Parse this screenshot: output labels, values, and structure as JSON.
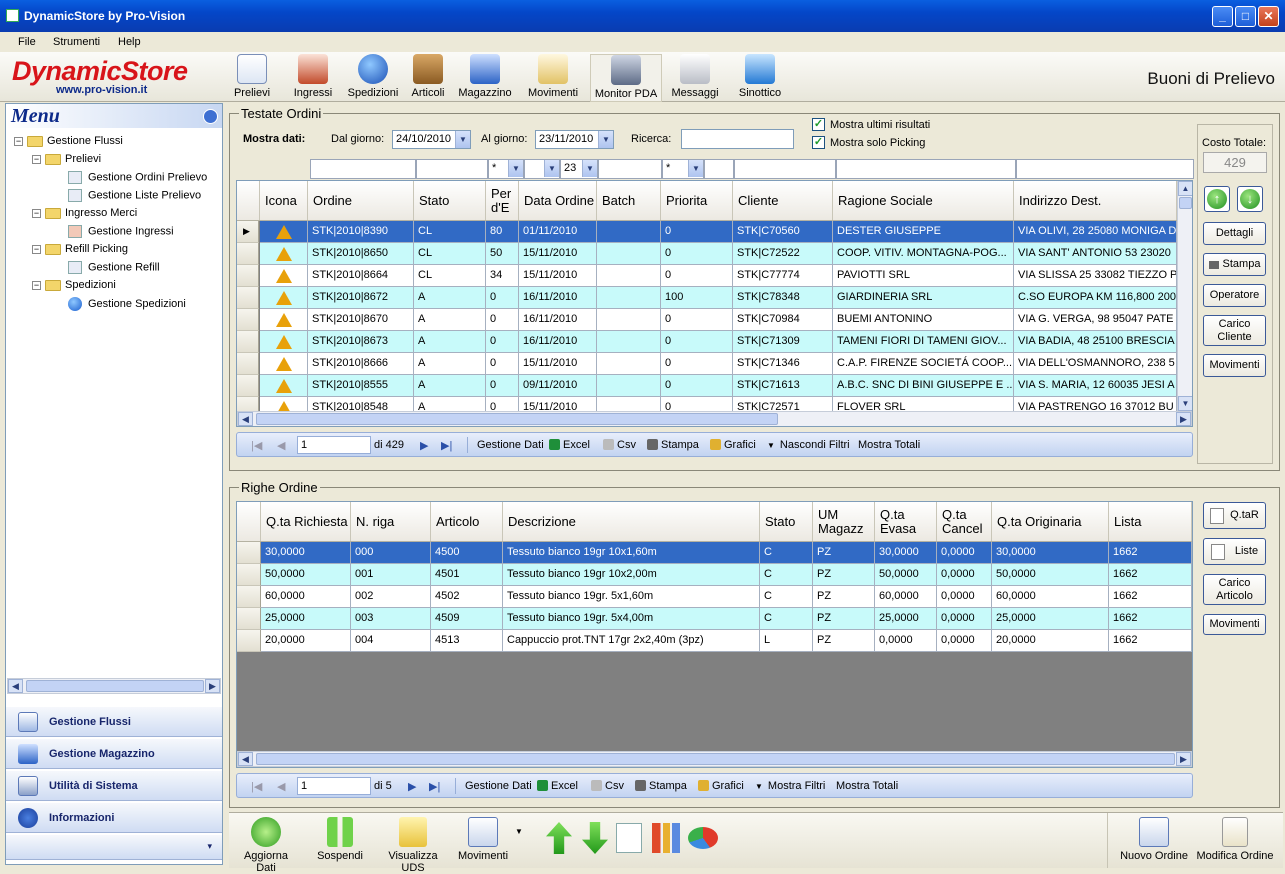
{
  "window": {
    "title": "DynamicStore by Pro-Vision"
  },
  "menubar": [
    "File",
    "Strumenti",
    "Help"
  ],
  "logo": {
    "name": "DynamicStore",
    "url": "www.pro-vision.it"
  },
  "toolbar": {
    "items": [
      "Prelievi",
      "Ingressi",
      "Spedizioni",
      "Articoli",
      "Magazzino",
      "Movimenti",
      "Monitor PDA",
      "Messaggi",
      "Sinottico"
    ],
    "selected": "Monitor PDA"
  },
  "page_title": "Buoni di Prelievo",
  "sidebar": {
    "title": "Menu",
    "tree": [
      {
        "label": "Gestione Flussi",
        "level": 0,
        "kind": "folder"
      },
      {
        "label": "Prelievi",
        "level": 1,
        "kind": "folder"
      },
      {
        "label": "Gestione Ordini Prelievo",
        "level": 2,
        "kind": "item"
      },
      {
        "label": "Gestione Liste Prelievo",
        "level": 2,
        "kind": "item"
      },
      {
        "label": "Ingresso Merci",
        "level": 1,
        "kind": "folder"
      },
      {
        "label": "Gestione Ingressi",
        "level": 2,
        "kind": "item"
      },
      {
        "label": "Refill Picking",
        "level": 1,
        "kind": "folder"
      },
      {
        "label": "Gestione Refill",
        "level": 2,
        "kind": "item"
      },
      {
        "label": "Spedizioni",
        "level": 1,
        "kind": "folder"
      },
      {
        "label": "Gestione Spedizioni",
        "level": 2,
        "kind": "item"
      }
    ],
    "nav_buttons": [
      "Gestione Flussi",
      "Gestione Magazzino",
      "Utilità di Sistema",
      "Informazioni"
    ]
  },
  "testate": {
    "title": "Testate Ordini",
    "mostra_dati": "Mostra dati:",
    "dal_label": "Dal giorno:",
    "dal_value": "24/10/2010",
    "al_label": "Al giorno:",
    "al_value": "23/11/2010",
    "ricerca_label": "Ricerca:",
    "ricerca_value": "",
    "chk_ultimi": "Mostra ultimi risultati",
    "chk_picking": "Mostra solo Picking",
    "filter_values": [
      "",
      "",
      "*",
      "",
      "23",
      "",
      "*",
      "",
      "",
      ""
    ],
    "columns": [
      "Icona",
      "Ordine",
      "Stato",
      "Per d'E",
      "Data Ordine",
      "Batch",
      "Priorita",
      "Cliente",
      "Ragione Sociale",
      "Indirizzo Dest."
    ],
    "rows": [
      [
        "STK|2010|8390",
        "CL",
        "80",
        "01/11/2010",
        "",
        "0",
        "STK|C70560",
        "DESTER GIUSEPPE",
        "VIA OLIVI, 28  25080 MONIGA D"
      ],
      [
        "STK|2010|8650",
        "CL",
        "50",
        "15/11/2010",
        "",
        "0",
        "STK|C72522",
        "COOP. VITIV. MONTAGNA-POG...",
        "VIA SANT' ANTONIO 53  23020"
      ],
      [
        "STK|2010|8664",
        "CL",
        "34",
        "15/11/2010",
        "",
        "0",
        "STK|C77774",
        "PAVIOTTI SRL",
        "VIA SLISSA 25  33082 TIEZZO P"
      ],
      [
        "STK|2010|8672",
        "A",
        "0",
        "16/11/2010",
        "",
        "100",
        "STK|C78348",
        "GIARDINERIA SRL",
        "C.SO EUROPA KM 116,800  200"
      ],
      [
        "STK|2010|8670",
        "A",
        "0",
        "16/11/2010",
        "",
        "0",
        "STK|C70984",
        "BUEMI ANTONINO",
        "VIA G. VERGA, 98  95047 PATE"
      ],
      [
        "STK|2010|8673",
        "A",
        "0",
        "16/11/2010",
        "",
        "0",
        "STK|C71309",
        "TAMENI FIORI DI TAMENI GIOV...",
        "VIA BADIA, 48  25100 BRESCIA"
      ],
      [
        "STK|2010|8666",
        "A",
        "0",
        "15/11/2010",
        "",
        "0",
        "STK|C71346",
        "C.A.P. FIRENZE SOCIETÁ COOP...",
        "VIA DELL'OSMANNORO, 238  5"
      ],
      [
        "STK|2010|8555",
        "A",
        "0",
        "09/11/2010",
        "",
        "0",
        "STK|C71613",
        "A.B.C. SNC DI BINI GIUSEPPE E ...",
        "VIA S. MARIA, 12  60035 JESI A"
      ],
      [
        "STK|2010|8548",
        "A",
        "0",
        "15/11/2010",
        "",
        "0",
        "STK|C72571",
        "FLOVER SRL",
        "VIA PASTRENGO 16  37012 BU"
      ]
    ],
    "nav": {
      "page": "1",
      "of": "di 429",
      "gestione": "Gestione Dati",
      "excel": "Excel",
      "csv": "Csv",
      "stampa": "Stampa",
      "grafici": "Grafici",
      "filtri": "Nascondi Filtri",
      "totali": "Mostra Totali"
    },
    "side": {
      "costo_label": "Costo Totale:",
      "costo_value": "429",
      "buttons": [
        "Dettagli",
        "Stampa",
        "Operatore",
        "Carico Cliente",
        "Movimenti"
      ]
    }
  },
  "righe": {
    "title": "Righe Ordine",
    "columns": [
      "Q.ta Richiesta",
      "N. riga",
      "Articolo",
      "Descrizione",
      "Stato",
      "UM Magazz",
      "Q.ta Evasa",
      "Q.ta Cancel",
      "Q.ta Originaria",
      "Lista"
    ],
    "rows": [
      [
        "30,0000",
        "000",
        "4500",
        "Tessuto bianco 19gr 10x1,60m",
        "C",
        "PZ",
        "30,0000",
        "0,0000",
        "30,0000",
        "1662"
      ],
      [
        "50,0000",
        "001",
        "4501",
        "Tessuto bianco 19gr 10x2,00m",
        "C",
        "PZ",
        "50,0000",
        "0,0000",
        "50,0000",
        "1662"
      ],
      [
        "60,0000",
        "002",
        "4502",
        "Tessuto bianco 19gr. 5x1,60m",
        "C",
        "PZ",
        "60,0000",
        "0,0000",
        "60,0000",
        "1662"
      ],
      [
        "25,0000",
        "003",
        "4509",
        "Tessuto bianco 19gr. 5x4,00m",
        "C",
        "PZ",
        "25,0000",
        "0,0000",
        "25,0000",
        "1662"
      ],
      [
        "20,0000",
        "004",
        "4513",
        "Cappuccio prot.TNT 17gr 2x2,40m (3pz)",
        "L",
        "PZ",
        "0,0000",
        "0,0000",
        "20,0000",
        "1662"
      ]
    ],
    "nav": {
      "page": "1",
      "of": "di 5",
      "gestione": "Gestione Dati",
      "excel": "Excel",
      "csv": "Csv",
      "stampa": "Stampa",
      "grafici": "Grafici",
      "filtri": "Mostra Filtri",
      "totali": "Mostra Totali"
    },
    "side": {
      "buttons": [
        "Q.taR",
        "Liste",
        "Carico Articolo",
        "Movimenti"
      ]
    }
  },
  "bottombar": {
    "left": [
      "Aggiorna Dati",
      "Sospendi",
      "Visualizza UDS",
      "Movimenti"
    ],
    "right": [
      "Nuovo Ordine",
      "Modifica Ordine"
    ]
  },
  "colors": {
    "selected_row": "#316ac5",
    "alt_row": "#c8fafa",
    "logo": "#d8141a",
    "title_bar": "#0a5fe0"
  }
}
